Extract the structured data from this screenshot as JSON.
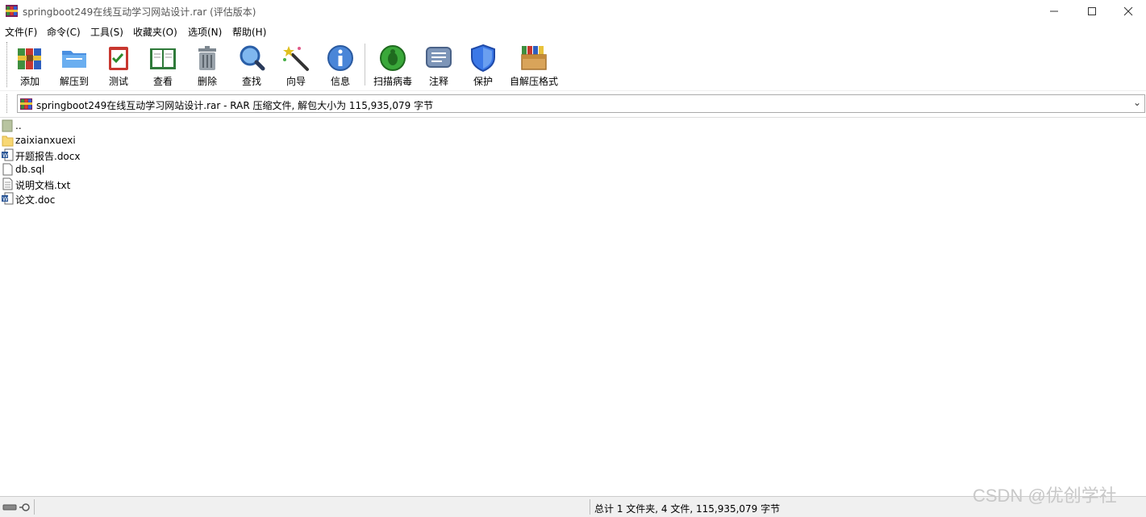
{
  "window": {
    "title": "springboot249在线互动学习网站设计.rar (评估版本)",
    "controls": {
      "minimize": "—",
      "maximize": "☐",
      "close": "✕"
    }
  },
  "menu": [
    "文件(F)",
    "命令(C)",
    "工具(S)",
    "收藏夹(O)",
    "选项(N)",
    "帮助(H)"
  ],
  "toolbar": [
    {
      "label": "添加",
      "icon": "add-archive-icon"
    },
    {
      "label": "解压到",
      "icon": "extract-to-folder-icon"
    },
    {
      "label": "测试",
      "icon": "test-clipboard-icon"
    },
    {
      "label": "查看",
      "icon": "view-book-icon"
    },
    {
      "label": "删除",
      "icon": "delete-trash-icon"
    },
    {
      "label": "查找",
      "icon": "find-magnifier-icon"
    },
    {
      "label": "向导",
      "icon": "wizard-wand-icon"
    },
    {
      "label": "信息",
      "icon": "info-icon"
    },
    {
      "label": "扫描病毒",
      "icon": "virus-scan-icon"
    },
    {
      "label": "注释",
      "icon": "comment-icon"
    },
    {
      "label": "保护",
      "icon": "protect-shield-icon"
    },
    {
      "label": "自解压格式",
      "icon": "sfx-box-icon"
    }
  ],
  "address": {
    "text": "springboot249在线互动学习网站设计.rar - RAR 压缩文件, 解包大小为 115,935,079 字节",
    "dropdown": "⌄"
  },
  "files": [
    {
      "name": "..",
      "type": "parent-folder"
    },
    {
      "name": "zaixianxuexi",
      "type": "folder"
    },
    {
      "name": "开题报告.docx",
      "type": "word"
    },
    {
      "name": "db.sql",
      "type": "file"
    },
    {
      "name": "说明文档.txt",
      "type": "text"
    },
    {
      "name": "论文.doc",
      "type": "word"
    }
  ],
  "status": {
    "summary": "总计 1 文件夹, 4 文件, 115,935,079 字节"
  },
  "watermark": "CSDN @优创学社",
  "colors": {
    "accent": "#1e6fd9",
    "folder": "#f7d774",
    "shield": "#3b78e7"
  }
}
